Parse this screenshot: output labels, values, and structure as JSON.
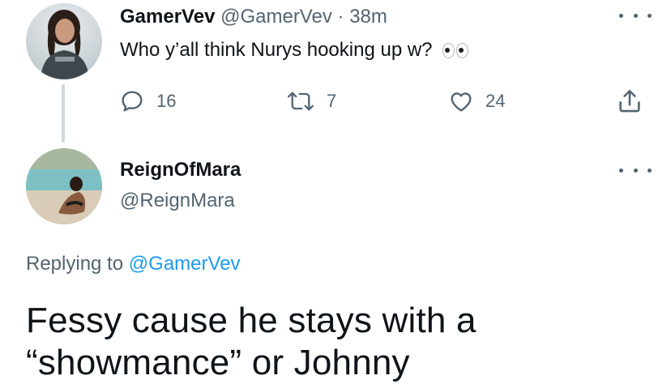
{
  "tweet1": {
    "display_name": "GamerVev",
    "handle": "@GamerVev",
    "separator": "·",
    "time": "38m",
    "text": "Who y’all think Nurys hooking up w?",
    "emoji": "eyes-emoji",
    "replies": "16",
    "retweets": "7",
    "likes": "24"
  },
  "tweet2": {
    "display_name": "ReignOfMara",
    "handle": "@ReignMara",
    "replying_prefix": "Replying to",
    "replying_to": "@GamerVev",
    "text_line1": "Fessy cause he stays with a",
    "text_line2": "“showmance” or Johnny"
  },
  "icons": {
    "reply": "speech-bubble-icon",
    "retweet": "retweet-icon",
    "like": "heart-icon",
    "share": "share-icon",
    "more": "more-dots-icon"
  },
  "colors": {
    "text": "#0f1419",
    "muted": "#536471",
    "link": "#1d9bf0",
    "thread_line": "#cfd9de"
  }
}
